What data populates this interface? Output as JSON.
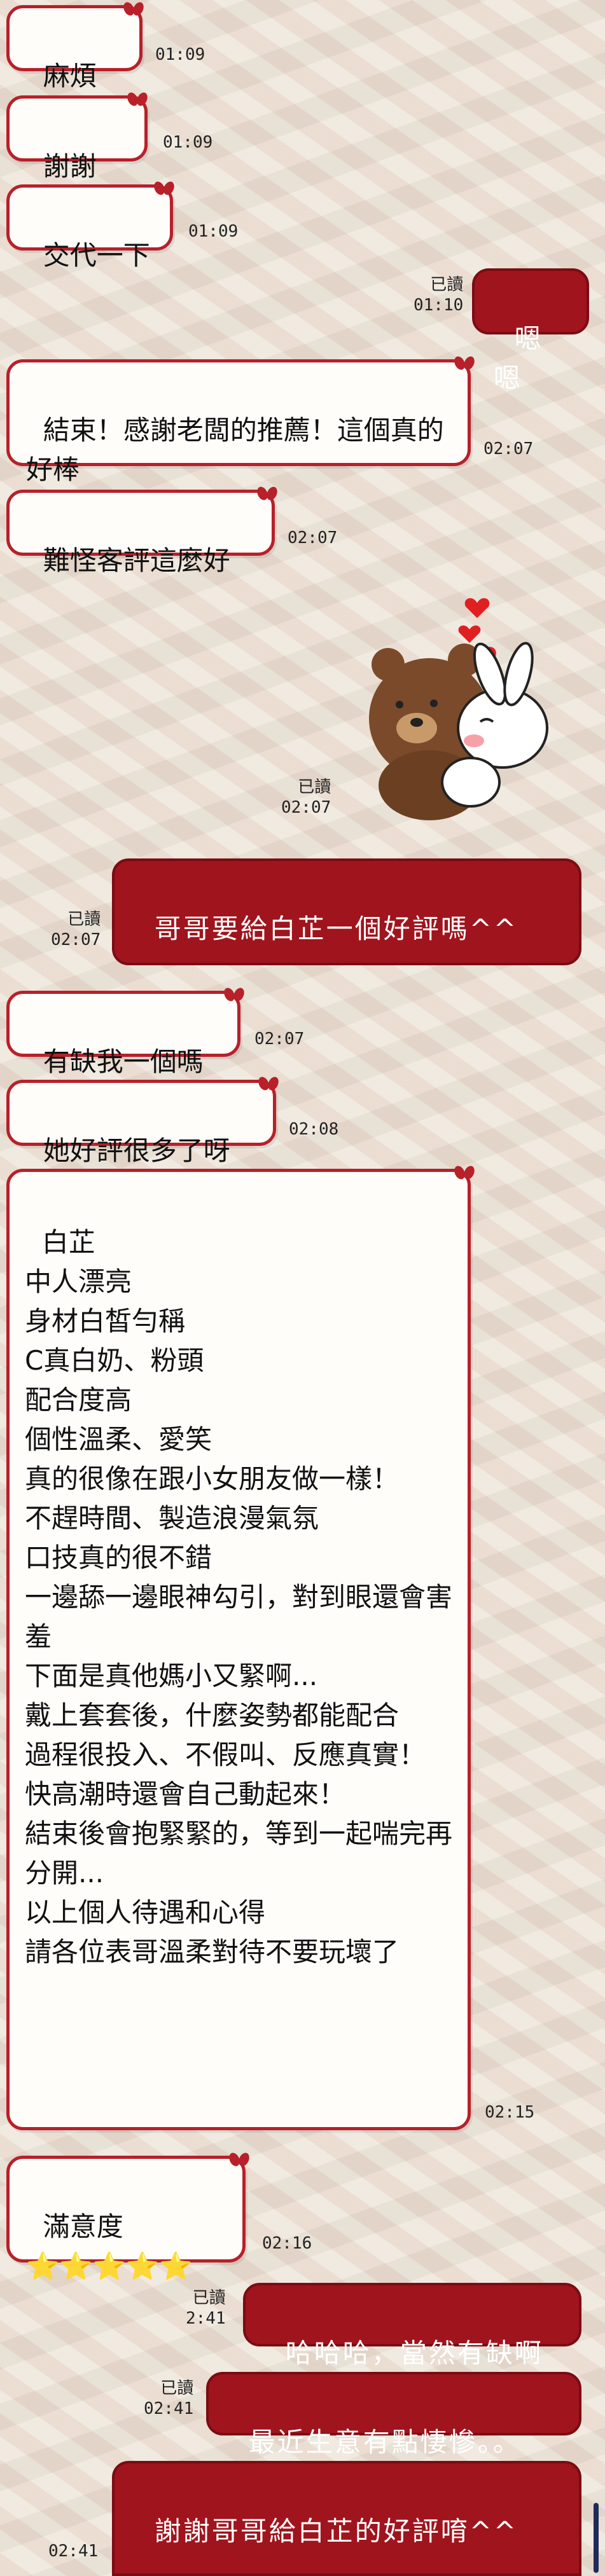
{
  "theme": {
    "in_border": "#b8202a",
    "out_bg": "#a0141d",
    "background": "#ebe3d6"
  },
  "messages": [
    {
      "text": "麻煩你",
      "time": "01:09"
    },
    {
      "text": "謝謝🙏",
      "time": "01:09"
    },
    {
      "text": "交代一下",
      "time": "01:09"
    },
    {
      "text": "嗯嗯",
      "time": "01:10",
      "read": "已讀"
    },
    {
      "text": "結束！感謝老闆的推薦！這個真的好棒",
      "time": "02:07"
    },
    {
      "text": "難怪客評這麼好",
      "time": "02:07"
    },
    {
      "sticker": "bear-hug-bunny-sticker",
      "time": "02:07",
      "read": "已讀"
    },
    {
      "text": "哥哥要給白芷一個好評嗎^^",
      "time": "02:07",
      "read": "已讀"
    },
    {
      "text": "有缺我一個嗎",
      "time": "02:07"
    },
    {
      "text": "她好評很多了呀",
      "time": "02:08"
    },
    {
      "text": "白芷\n中人漂亮\n身材白皙勻稱\nC真白奶、粉頭\n配合度高\n個性溫柔、愛笑\n真的很像在跟小女朋友做一樣！\n不趕時間、製造浪漫氣氛\n口技真的很不錯\n一邊舔一邊眼神勾引，對到眼還會害羞\n下面是真他媽小又緊啊...\n戴上套套後，什麼姿勢都能配合\n過程很投入、不假叫、反應真實！\n快高潮時還會自己動起來！\n結束後會抱緊緊的，等到一起喘完再分開...\n以上個人待遇和心得\n請各位表哥溫柔對待不要玩壞了",
      "time": "02:15"
    },
    {
      "text": "滿意度\n⭐⭐⭐⭐⭐",
      "time": "02:16"
    },
    {
      "text": "哈哈哈，當然有缺啊",
      "time": "2:41",
      "read": "已讀"
    },
    {
      "text": "最近生意有點悽慘。。",
      "time": "02:41",
      "read": "已讀"
    },
    {
      "text": "謝謝哥哥給白芷的好評唷^^",
      "time": "02:41",
      "read": ""
    }
  ]
}
